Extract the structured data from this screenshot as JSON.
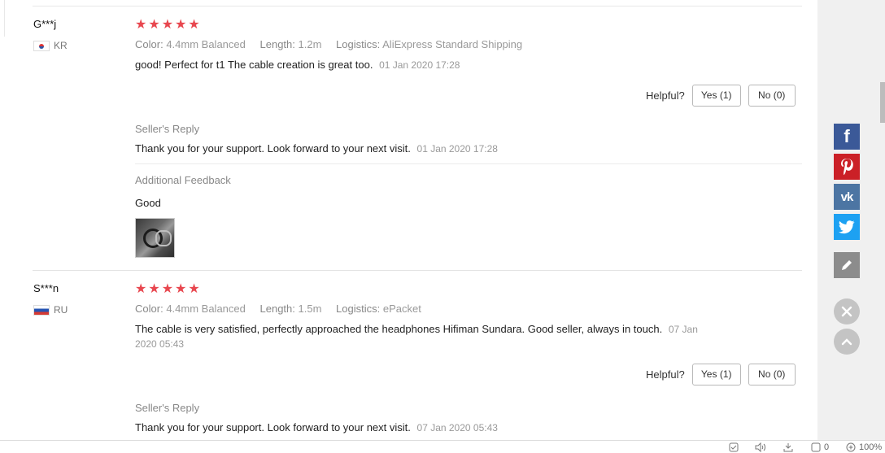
{
  "reviews": [
    {
      "user": "G***j",
      "country": "KR",
      "stars": 5,
      "color_key": "Color:",
      "color_val": "4.4mm Balanced",
      "length_key": "Length:",
      "length_val": "1.2m",
      "logistics_key": "Logistics:",
      "logistics_val": "AliExpress Standard Shipping",
      "text": "good! Perfect for t1 The cable creation is great too.",
      "date": "01 Jan 2020 17:28",
      "helpful_label": "Helpful?",
      "yes_label": "Yes (1)",
      "no_label": "No (0)",
      "seller_reply_heading": "Seller's Reply",
      "seller_reply_text": "Thank you for your support. Look forward to your next visit.",
      "seller_reply_date": "01 Jan 2020 17:28",
      "additional_heading": "Additional Feedback",
      "additional_text": "Good"
    },
    {
      "user": "S***n",
      "country": "RU",
      "stars": 5,
      "color_key": "Color:",
      "color_val": "4.4mm Balanced",
      "length_key": "Length:",
      "length_val": "1.5m",
      "logistics_key": "Logistics:",
      "logistics_val": "ePacket",
      "text": "The cable is very satisfied, perfectly approached the headphones Hifiman Sundara. Good seller, always in touch.",
      "date_line1": "07 Jan",
      "date_line2": "2020 05:43",
      "helpful_label": "Helpful?",
      "yes_label": "Yes (1)",
      "no_label": "No (0)",
      "seller_reply_heading": "Seller's Reply",
      "seller_reply_text": "Thank you for your support. Look forward to your next visit.",
      "seller_reply_date": "07 Jan 2020 05:43"
    }
  ],
  "share": {
    "facebook_icon": "facebook-icon",
    "pinterest_icon": "pinterest-icon",
    "vk_icon": "vk-icon",
    "twitter_icon": "twitter-icon",
    "edit_icon": "pencil-icon",
    "close_icon": "close-icon",
    "up_icon": "chevron-up-icon",
    "facebook_color": "#3b5998",
    "pinterest_color": "#cb2027",
    "vk_color": "#4c75a3",
    "twitter_color": "#1da1f2"
  },
  "status_bar": {
    "count": "0",
    "zoom": "100%"
  },
  "colors": {
    "star": "#e8474f"
  }
}
